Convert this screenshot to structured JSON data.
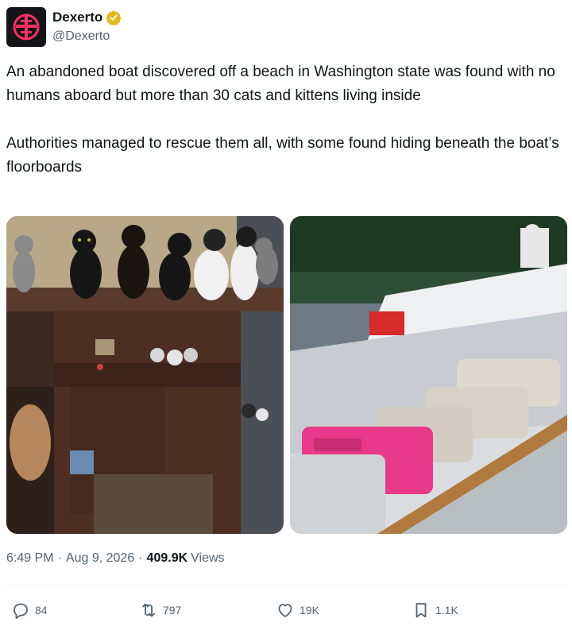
{
  "account": {
    "display_name": "Dexerto",
    "handle": "@Dexerto",
    "verified": true,
    "avatar_icon": "dexerto-logo-icon",
    "brand_color": "#ff2e63"
  },
  "tweet": {
    "paragraphs": [
      "An abandoned boat discovered off a beach in Washington state was found with no humans aboard but more than 30 cats and kittens living inside",
      "Authorities managed to rescue them all, with some found hiding beneath the boat’s floorboards"
    ]
  },
  "media": [
    {
      "alt_icon": "cats-on-boat-photo"
    },
    {
      "alt_icon": "pet-carriers-on-boat-photo"
    }
  ],
  "meta": {
    "time": "6:49 PM",
    "date": "Aug 9, 2026",
    "views_count": "409.9K",
    "views_label": "Views"
  },
  "actions": {
    "replies": "84",
    "reposts": "797",
    "likes": "19K",
    "bookmarks": "1.1K"
  },
  "colors": {
    "text_primary": "#0f1419",
    "text_secondary": "#536471",
    "verified_gold": "#e2b719",
    "carrier_pink": "#e8398a"
  }
}
